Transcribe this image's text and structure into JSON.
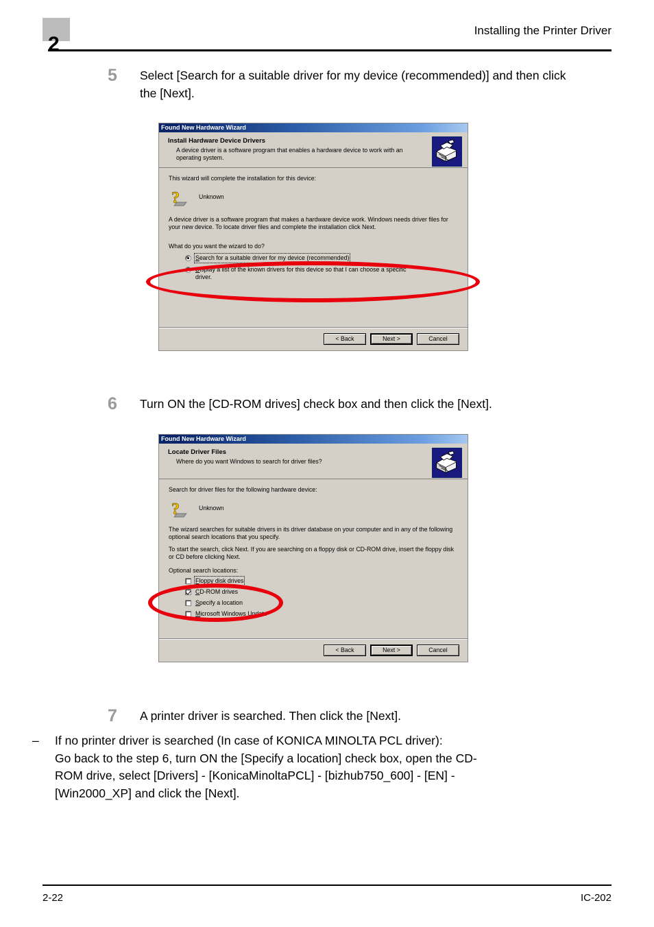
{
  "page": {
    "chapter_number": "2",
    "header_title": "Installing the Printer Driver",
    "footer_left": "2-22",
    "footer_right": "IC-202",
    "accent_red": "#e8000d",
    "chapter_badge_color": "#bcbcbc",
    "step_number_color": "#9a9a9a"
  },
  "steps": [
    {
      "number": "5",
      "text": "Select [Search for a suitable driver for my device (recommended)] and then click the [Next]."
    },
    {
      "number": "6",
      "text": "Turn ON the [CD-ROM drives] check box and then click the [Next]."
    },
    {
      "number": "7",
      "text": "A printer driver is searched. Then click the [Next].",
      "substep": {
        "dash": "–",
        "text": "If no printer driver is searched (In case of KONICA MINOLTA PCL driver):\nGo back to the step 6, turn ON the [Specify a location] check box, open the CD-ROM drive, select [Drivers] - [KonicaMinoltaPCL] - [bizhub750_600] - [EN] - [Win2000_XP] and click the [Next]."
      }
    }
  ],
  "dialog1": {
    "title": "Found New Hardware Wizard",
    "header_title": "Install Hardware Device Drivers",
    "header_sub": "A device driver is a software program that enables a hardware device to work with an operating system.",
    "icon": "hardware-wizard-icon",
    "para1": "This wizard will complete the installation for this device:",
    "device_name": "Unknown",
    "device_icon": "unknown-device-question-icon",
    "para2": "A device driver is a software program that makes a hardware device work. Windows needs driver files for your new device. To locate driver files and complete the installation click Next.",
    "prompt": "What do you want the wizard to do?",
    "options": [
      {
        "label_pre": "S",
        "label_rest": "earch for a suitable driver for my device (recommended)",
        "selected": true
      },
      {
        "label_pre": "D",
        "label_rest": "isplay a list of the known drivers for this device so that I can choose a specific driver.",
        "selected": false
      }
    ],
    "buttons": {
      "back": "< Back",
      "next": "Next >",
      "cancel": "Cancel"
    }
  },
  "dialog2": {
    "title": "Found New Hardware Wizard",
    "header_title": "Locate Driver Files",
    "header_sub": "Where do you want Windows to search for driver files?",
    "icon": "hardware-wizard-icon",
    "para1": "Search for driver files for the following hardware device:",
    "device_name": "Unknown",
    "device_icon": "unknown-device-question-icon",
    "para2": "The wizard searches for suitable drivers in its driver database on your computer and in any of the following optional search locations that you specify.",
    "para3": "To start the search, click Next. If you are searching on a floppy disk or CD-ROM drive, insert the floppy disk or CD before clicking Next.",
    "optional_label": "Optional search locations:",
    "checkboxes": [
      {
        "label_pre": "F",
        "label_rest": "loppy disk drives",
        "checked": false
      },
      {
        "label_pre": "C",
        "label_rest": "D-ROM drives",
        "checked": true
      },
      {
        "label_pre": "S",
        "label_rest": "pecify a location",
        "checked": false
      },
      {
        "label_pre": "M",
        "label_rest": "icrosoft Windows Update",
        "checked": false
      }
    ],
    "buttons": {
      "back": "< Back",
      "next": "Next >",
      "cancel": "Cancel"
    }
  }
}
